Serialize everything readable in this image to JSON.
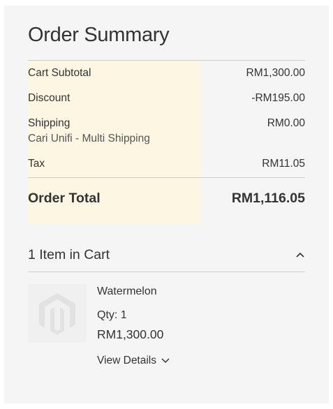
{
  "summary": {
    "title": "Order Summary",
    "rows": [
      {
        "label": "Cart Subtotal",
        "value": "RM1,300.00"
      },
      {
        "label": "Discount",
        "value": "-RM195.00"
      },
      {
        "label": "Shipping",
        "sub_label": "Cari Unifi - Multi Shipping",
        "value": "RM0.00"
      },
      {
        "label": "Tax",
        "value": "RM11.05"
      }
    ],
    "total": {
      "label": "Order Total",
      "value": "RM1,116.05"
    }
  },
  "cart": {
    "heading": "1 Item in Cart",
    "items": [
      {
        "name": "Watermelon",
        "qty": "Qty: 1",
        "price": "RM1,300.00",
        "details_link": "View Details",
        "thumbnail_icon": "magento-placeholder-icon"
      }
    ]
  },
  "icons": {
    "collapse": "chevron-up-icon",
    "expand_details": "chevron-down-icon"
  },
  "colors": {
    "panel_bg": "#f5f5f5",
    "highlight_bg": "#fdf6e3",
    "text": "#333333",
    "rule": "#cccccc"
  }
}
